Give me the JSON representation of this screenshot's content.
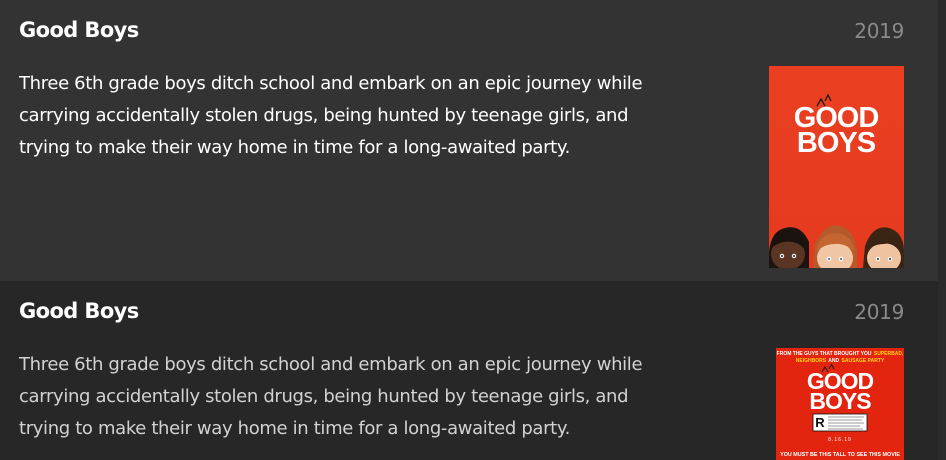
{
  "items": [
    {
      "title": "Good Boys",
      "year": "2019",
      "description": "Three 6th grade boys ditch school and embark on an epic journey while carrying accidentally stolen drugs, being hunted by teenage girls, and trying to make their way home in time for a long-awaited party.",
      "poster": {
        "line1": "GOOD",
        "line2": "BOYS",
        "bg_color": "#e8371f"
      }
    },
    {
      "title": "Good Boys",
      "year": "2019",
      "description": "Three 6th grade boys ditch school and embark on an epic journey while carrying accidentally stolen drugs, being hunted by teenage girls, and trying to make their way home in time for a long-awaited party.",
      "poster": {
        "top_text_a": "FROM THE GUYS THAT BROUGHT YOU",
        "top_text_b": "SUPERBAD,",
        "top_text_c": "NEIGHBORS",
        "top_text_d": "AND",
        "top_text_e": "SAUSAGE PARTY",
        "line1": "GOOD",
        "line2": "BOYS",
        "rating": "R",
        "date": "8.16.19",
        "bottom_text": "YOU MUST BE THIS TALL TO SEE THIS MOVIE",
        "bg_color": "#e3250f"
      }
    }
  ]
}
